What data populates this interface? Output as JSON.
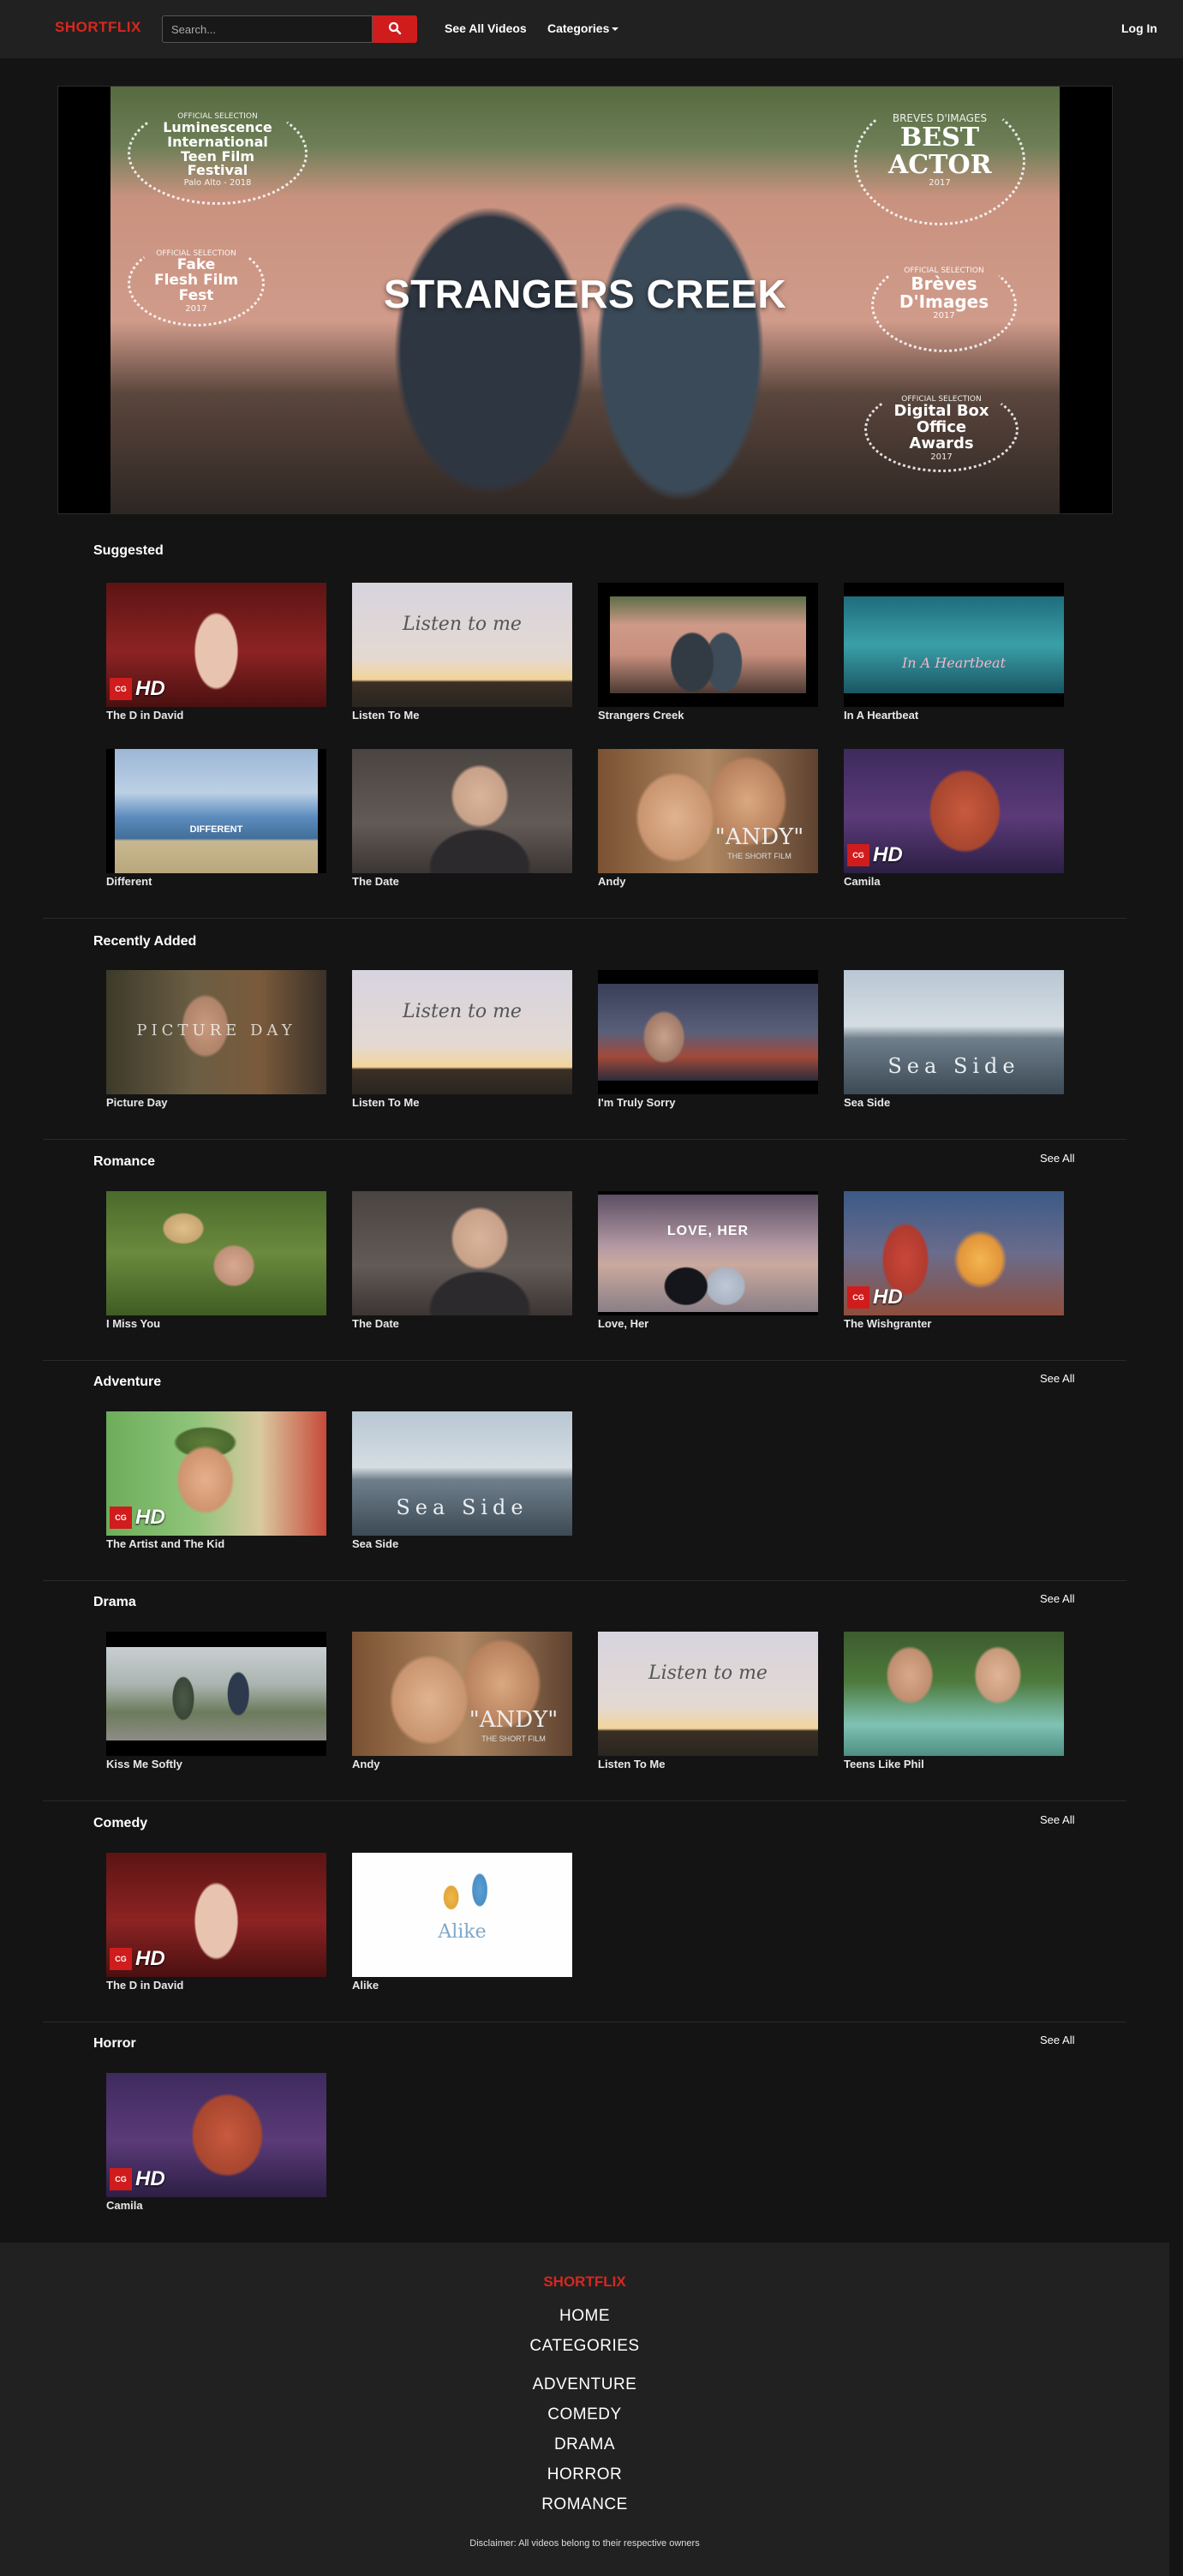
{
  "header": {
    "brand": "SHORTFLIX",
    "search_placeholder": "Search...",
    "see_all_videos": "See All Videos",
    "categories": "Categories",
    "login": "Log In"
  },
  "hero": {
    "title": "STRANGERS CREEK",
    "laurels": [
      {
        "top": "OFFICIAL SELECTION",
        "main": "Luminescence International Teen Film Festival",
        "bottom": "Palo Alto - 2018"
      },
      {
        "top": "OFFICIAL SELECTION",
        "main": "Fake Flesh Film Fest",
        "bottom": "2017"
      },
      {
        "top": "BREVES D'IMAGES",
        "main": "BEST ACTOR",
        "bottom": "2017"
      },
      {
        "top": "OFFICIAL SELECTION",
        "main": "Brèves D'Images",
        "bottom": "2017"
      },
      {
        "top": "OFFICIAL SELECTION",
        "main": "Digital Box Office Awards",
        "bottom": "2017"
      }
    ]
  },
  "sections": [
    {
      "title": "Suggested",
      "see_all": "",
      "items": [
        "The D in David",
        "Listen To Me",
        "Strangers Creek",
        "In A Heartbeat",
        "Different",
        "The Date",
        "Andy",
        "Camila"
      ]
    },
    {
      "title": "Recently Added",
      "see_all": "",
      "items": [
        "Picture Day",
        "Listen To Me",
        "I'm Truly Sorry",
        "Sea Side"
      ]
    },
    {
      "title": "Romance",
      "see_all": "See All",
      "items": [
        "I Miss You",
        "The Date",
        "Love, Her",
        "The Wishgranter"
      ]
    },
    {
      "title": "Adventure",
      "see_all": "See All",
      "items": [
        "The Artist and The Kid",
        "Sea Side"
      ]
    },
    {
      "title": "Drama",
      "see_all": "See All",
      "items": [
        "Kiss Me Softly",
        "Andy",
        "Listen To Me",
        "Teens Like Phil"
      ]
    },
    {
      "title": "Comedy",
      "see_all": "See All",
      "items": [
        "The D in David",
        "Alike"
      ]
    },
    {
      "title": "Horror",
      "see_all": "See All",
      "items": [
        "Camila"
      ]
    }
  ],
  "thumb_text": {
    "listen": "Listen to me",
    "different": "DIFFERENT",
    "andy": "\"ANDY\"",
    "andy_sub": "THE SHORT FILM",
    "heartbeat": "In A Heartbeat",
    "picture_day": "PICTURE DAY",
    "sea_side": "Sea Side",
    "love_her": "LOVE, HER",
    "alike": "Alike",
    "badge_cg": "CG",
    "badge_hd": "HD"
  },
  "footer": {
    "brand": "SHORTFLIX",
    "links": [
      "HOME",
      "CATEGORIES",
      "ADVENTURE",
      "COMEDY",
      "DRAMA",
      "HORROR",
      "ROMANCE"
    ],
    "disclaimer": "Disclaimer: All videos belong to their respective owners"
  },
  "colors": {
    "brand_red": "#d6281f",
    "page_bg": "#141414",
    "header_bg": "#212121"
  }
}
